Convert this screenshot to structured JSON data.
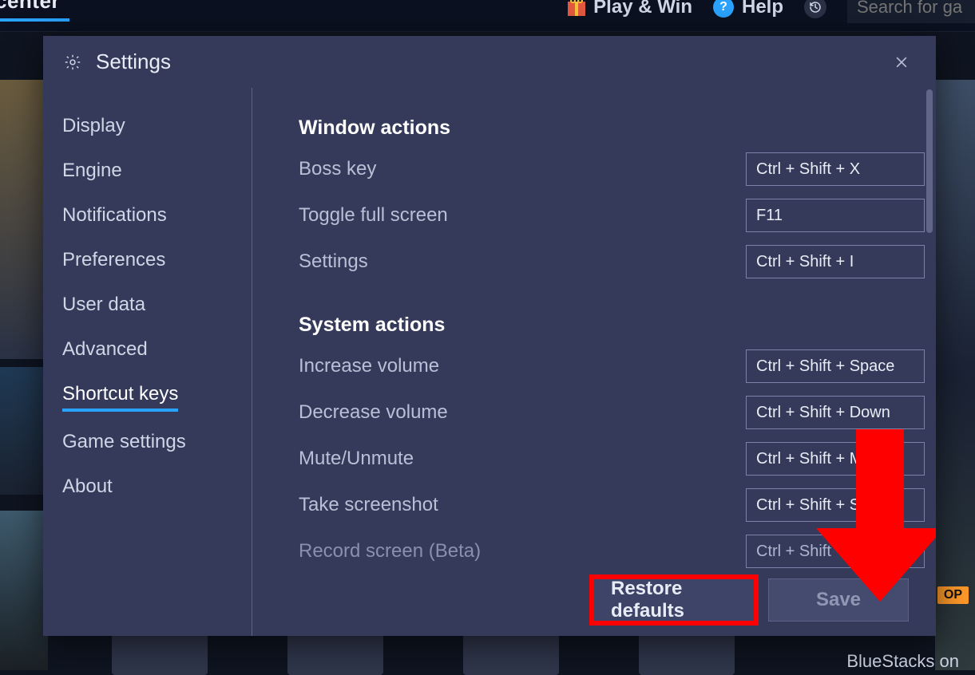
{
  "topbar": {
    "tab_fragment": "center",
    "play_win": "Play & Win",
    "help": "Help",
    "search_placeholder": "Search for ga"
  },
  "background": {
    "bottom_label": "BlueStacks on",
    "top_badge": "OP"
  },
  "modal": {
    "title": "Settings",
    "close_aria": "Close"
  },
  "sidebar": {
    "items": [
      {
        "label": "Display"
      },
      {
        "label": "Engine"
      },
      {
        "label": "Notifications"
      },
      {
        "label": "Preferences"
      },
      {
        "label": "User data"
      },
      {
        "label": "Advanced"
      },
      {
        "label": "Shortcut keys",
        "active": true
      },
      {
        "label": "Game settings"
      },
      {
        "label": "About"
      }
    ]
  },
  "content": {
    "sections": [
      {
        "title": "Window actions",
        "rows": [
          {
            "label": "Boss key",
            "value": "Ctrl + Shift + X"
          },
          {
            "label": "Toggle full screen",
            "value": "F11"
          },
          {
            "label": "Settings",
            "value": "Ctrl + Shift + I"
          }
        ]
      },
      {
        "title": "System actions",
        "rows": [
          {
            "label": "Increase volume",
            "value": "Ctrl + Shift + Space"
          },
          {
            "label": "Decrease volume",
            "value": "Ctrl + Shift + Down"
          },
          {
            "label": "Mute/Unmute",
            "value": "Ctrl + Shift + M"
          },
          {
            "label": "Take screenshot",
            "value": "Ctrl + Shift + S"
          },
          {
            "label": "Record screen (Beta)",
            "value": "Ctrl + Shift + R",
            "faded": true
          }
        ]
      }
    ]
  },
  "footer": {
    "restore": "Restore defaults",
    "save": "Save"
  }
}
